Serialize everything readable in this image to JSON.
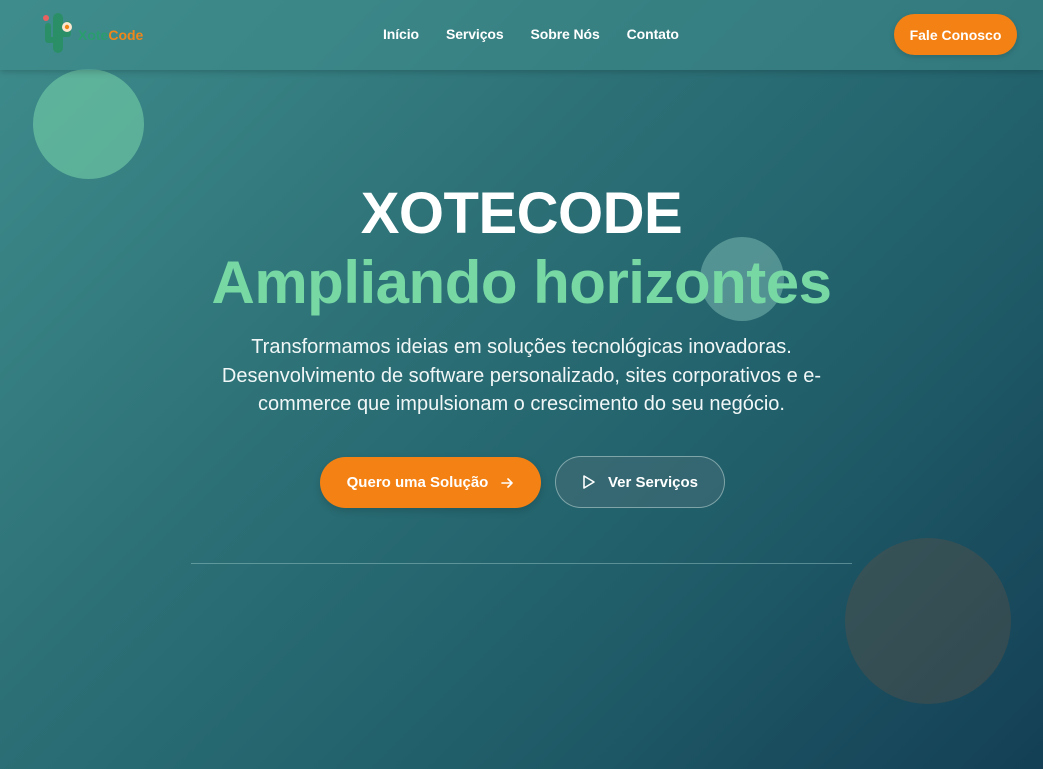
{
  "brand": {
    "name_part1": "Xote",
    "name_part2": "Code"
  },
  "nav": {
    "items": [
      "Início",
      "Serviços",
      "Sobre Nós",
      "Contato"
    ],
    "cta_label": "Fale Conosco"
  },
  "hero": {
    "title": "XOTECODE",
    "subtitle": "Ampliando horizontes",
    "description": "Transformamos ideias em soluções tecnológicas inovadoras. Desenvolvimento de software personalizado, sites corporativos e e-commerce que impulsionam o crescimento do seu negócio.",
    "primary_button": "Quero uma Solução",
    "secondary_button": "Ver Serviços"
  },
  "icons": {
    "primary_button_icon": "arrow-right-icon",
    "secondary_button_icon": "play-icon",
    "logo_icon": "cactus-flower-icon"
  },
  "colors": {
    "accent_orange": "#f48114",
    "accent_green": "#77d8a4",
    "background_start": "#3f8d8d",
    "background_end": "#143f55"
  }
}
